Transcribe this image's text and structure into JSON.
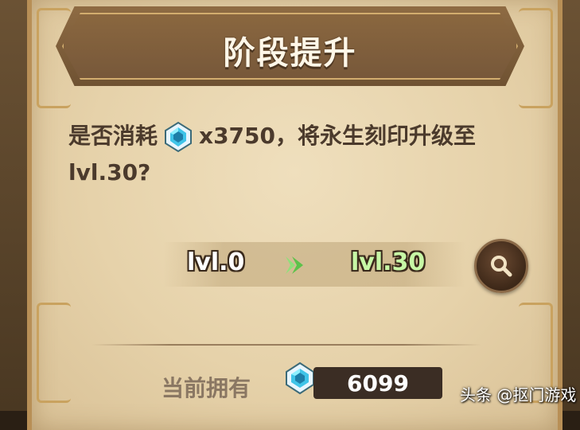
{
  "dialog": {
    "title": "阶段提升",
    "question_prefix": "是否消耗",
    "cost_amount": "x3750",
    "question_suffix": "，将永生刻印升级至",
    "question_target": "lvl.30?",
    "gem_icon": "blue-crystal-icon"
  },
  "level_change": {
    "from": "lvl.0",
    "to": "lvl.30",
    "arrow_icon": "green-right-arrow-icon",
    "to_color": "#c7f7a5"
  },
  "search_button": {
    "icon": "magnifier-icon"
  },
  "owned": {
    "label": "当前拥有",
    "value": "6099",
    "icon": "blue-crystal-icon"
  },
  "watermark": "头条 @抠门游戏"
}
